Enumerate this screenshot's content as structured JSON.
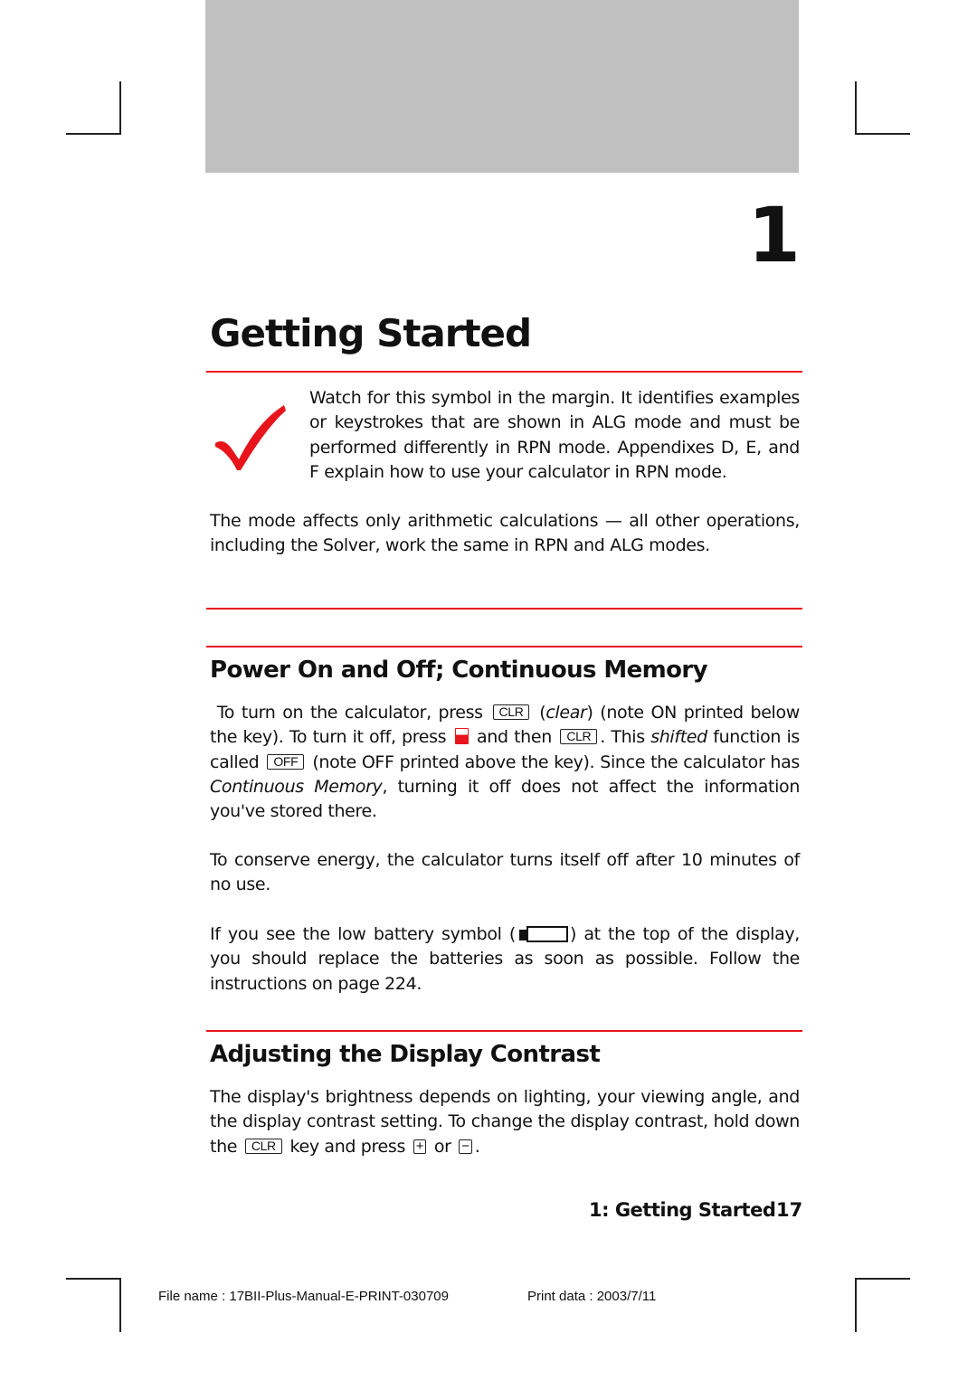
{
  "chapter": {
    "number": "1",
    "title": "Getting Started"
  },
  "note": {
    "icon": "red-checkmark-icon",
    "text": "Watch for this symbol in the margin. It identifies examples or keystrokes that are shown in ALG mode and must be performed differently in RPN mode. Appendixes D, E, and F explain how to use your calculator in RPN mode."
  },
  "intro": {
    "text": "The mode affects only arithmetic calculations — all other operations, including the Solver, work the same in RPN and ALG modes."
  },
  "section_power": {
    "heading": "Power On and Off; Continuous Memory",
    "p1": {
      "t1": "To turn on the calculator, press",
      "key_clr": "CLR",
      "t2_italic": "clear",
      "t3": "(note ON printed below the key). To turn it off, press",
      "t4": "and then",
      "key_clr2": "CLR",
      "t5": ". This",
      "t6_italic": "shifted",
      "t7": "function is called",
      "key_off": "OFF",
      "t8": "(note OFF printed above the key). Since the calculator has",
      "t9_italic": "Continuous Memory",
      "t10": ", turning it off does not affect the information you've stored there."
    },
    "p2": "To conserve energy, the calculator turns itself off after 10 minutes of no use.",
    "p3": {
      "t1": "If you see the low battery symbol (",
      "t2": ") at the top of the display, you should replace the batteries as soon as possible. Follow the instructions on page 224."
    }
  },
  "section_contrast": {
    "heading": "Adjusting the Display Contrast",
    "p1": {
      "t1": "The display's brightness depends on lighting, your viewing angle, and the display contrast setting. To change the display contrast, hold down the",
      "key_clr": "CLR",
      "t2": "key and press",
      "key_plus": "+",
      "t3": "or",
      "key_minus": "−",
      "t4": "."
    }
  },
  "footer": {
    "running_title": "1: Getting Started",
    "page_number": "17"
  },
  "print_meta": {
    "file_name": "File name : 17BII-Plus-Manual-E-PRINT-030709",
    "print_data": "Print data : 2003/7/11"
  },
  "colors": {
    "accent_red": "#e8141c",
    "header_gray": "#c0c0c0"
  }
}
